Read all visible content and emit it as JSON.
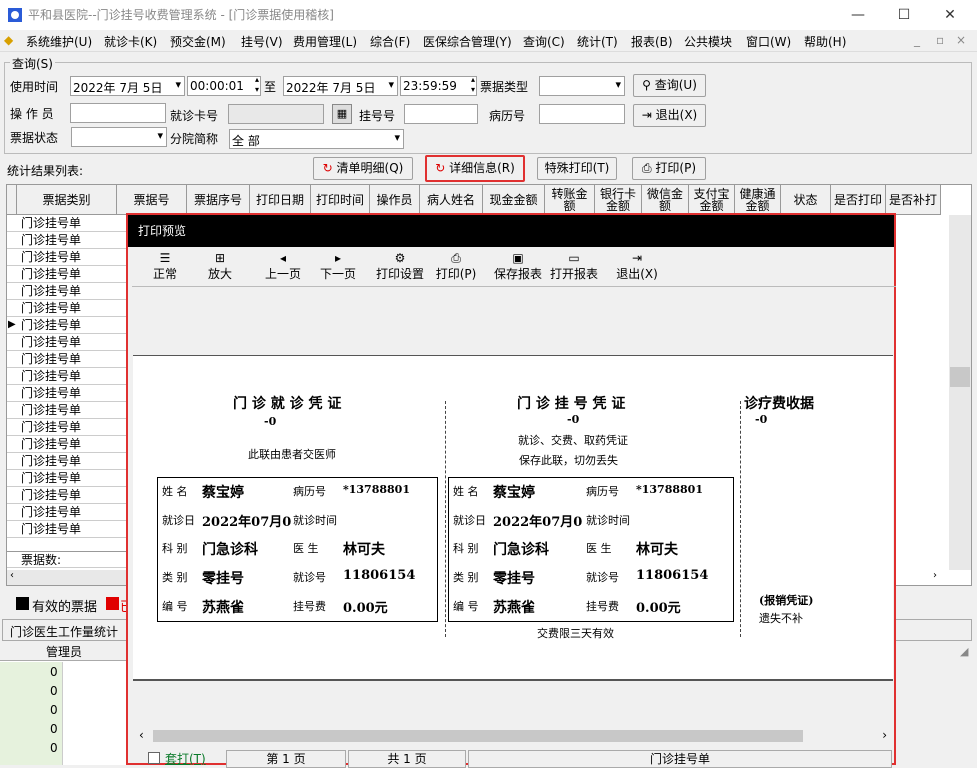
{
  "window": {
    "title": "平和县医院--门诊挂号收费管理系统 - [门诊票据使用稽核]"
  },
  "menu": [
    "系统维护(U)",
    "就诊卡(K)",
    "预交金(M)",
    "挂号(V)",
    "费用管理(L)",
    "综合(F)",
    "医保综合管理(Y)",
    "查询(C)",
    "统计(T)",
    "报表(B)",
    "公共模块",
    "窗口(W)",
    "帮助(H)"
  ],
  "query": {
    "group_label": "查询(S)",
    "time_label": "使用时间",
    "date_from": "2022年 7月 5日",
    "time_from": "00:00:01",
    "to_label": "至",
    "date_to": "2022年 7月 5日",
    "time_to": "23:59:59",
    "ticket_type_label": "票据类型",
    "ticket_type_value": "",
    "query_btn": "查询(U)",
    "exit_btn": "退出(X)",
    "operator_label": "操 作 员",
    "operator_value": "",
    "card_label": "就诊卡号",
    "card_value": "",
    "reg_label": "挂号号",
    "reg_value": "",
    "record_label": "病历号",
    "record_value": "",
    "status_label": "票据状态",
    "status_value": "",
    "branch_label": "分院简称",
    "branch_value": "全 部"
  },
  "results": {
    "label": "统计结果列表:",
    "btn_list": "清单明细(Q)",
    "btn_detail": "详细信息(R)",
    "btn_special": "特殊打印(T)",
    "btn_print": "打印(P)"
  },
  "columns": [
    "票据类别",
    "票据号",
    "票据序号",
    "打印日期",
    "打印时间",
    "操作员",
    "病人姓名",
    "现金金额",
    "转账金额",
    "银行卡金额",
    "微信金额",
    "支付宝金额",
    "健康通金额",
    "状态",
    "是否打印",
    "是否补打"
  ],
  "rows": [
    "门诊挂号单",
    "门诊挂号单",
    "门诊挂号单",
    "门诊挂号单",
    "门诊挂号单",
    "门诊挂号单",
    "门诊挂号单",
    "门诊挂号单",
    "门诊挂号单",
    "门诊挂号单",
    "门诊挂号单",
    "门诊挂号单",
    "门诊挂号单",
    "门诊挂号单",
    "门诊挂号单",
    "门诊挂号单",
    "门诊挂号单",
    "门诊挂号单",
    "门诊挂号单"
  ],
  "rows_footer": "票据数:",
  "legend": {
    "valid": "有效的票据",
    "invalid": "已"
  },
  "bottom": {
    "tab": "门诊医生工作量统计",
    "col_admin": "管理员",
    "values": [
      "0",
      "0",
      "0",
      "0",
      "0"
    ]
  },
  "colors": {
    "highlight": "#e03030",
    "legend_valid": "#000000",
    "legend_red": "#e00000"
  },
  "preview": {
    "title": "打印预览",
    "tools": [
      {
        "icon": "normal-icon",
        "label": "正常"
      },
      {
        "icon": "zoom-icon",
        "label": "放大"
      },
      {
        "icon": "prev-page-icon",
        "label": "上一页"
      },
      {
        "icon": "next-page-icon",
        "label": "下一页"
      },
      {
        "icon": "print-setup-icon",
        "label": "打印设置"
      },
      {
        "icon": "printer-icon",
        "label": "打印(P)"
      },
      {
        "icon": "save-icon",
        "label": "保存报表"
      },
      {
        "icon": "open-folder-icon",
        "label": "打开报表"
      },
      {
        "icon": "exit-icon",
        "label": "退出(X)"
      }
    ],
    "status": {
      "reprint": "套打(T)",
      "page": "第 1 页",
      "total": "共 1 页",
      "doc": "门诊挂号单"
    }
  },
  "receipts": [
    {
      "title": "门 诊 就 诊 凭 证",
      "num": "-0",
      "note1": "此联由患者交医师",
      "note2": "",
      "name_lbl": "姓  名",
      "name": "蔡宝婷",
      "rec_lbl": "病历号",
      "rec": "*13788801",
      "date_lbl": "就诊日",
      "date": "2022年07月0",
      "time_lbl": "就诊时间",
      "dept_lbl": "科  别",
      "dept": "门急诊科",
      "doc_lbl": "医  生",
      "doc": "林可夫",
      "type_lbl": "类  别",
      "type": "零挂号",
      "no_lbl": "就诊号",
      "no": "11806154",
      "op_lbl": "编  号",
      "op": "苏燕雀",
      "fee_lbl": "挂号费",
      "fee": "0.00元",
      "foot": ""
    },
    {
      "title": "门 诊 挂 号 凭 证",
      "num": "-0",
      "note1": "就诊、交费、取药凭证",
      "note2": "保存此联，切勿丢失",
      "name_lbl": "姓  名",
      "name": "蔡宝婷",
      "rec_lbl": "病历号",
      "rec": "*13788801",
      "date_lbl": "就诊日",
      "date": "2022年07月0",
      "time_lbl": "就诊时间",
      "dept_lbl": "科  别",
      "dept": "门急诊科",
      "doc_lbl": "医  生",
      "doc": "林可夫",
      "type_lbl": "类  别",
      "type": "零挂号",
      "no_lbl": "就诊号",
      "no": "11806154",
      "op_lbl": "编  号",
      "op": "苏燕雀",
      "fee_lbl": "挂号费",
      "fee": "0.00元",
      "foot": "交费限三天有效"
    }
  ],
  "receipt3": {
    "title": "诊疗费收据",
    "num": "-0",
    "note1": "(报销凭证)",
    "note2": "遗失不补"
  }
}
